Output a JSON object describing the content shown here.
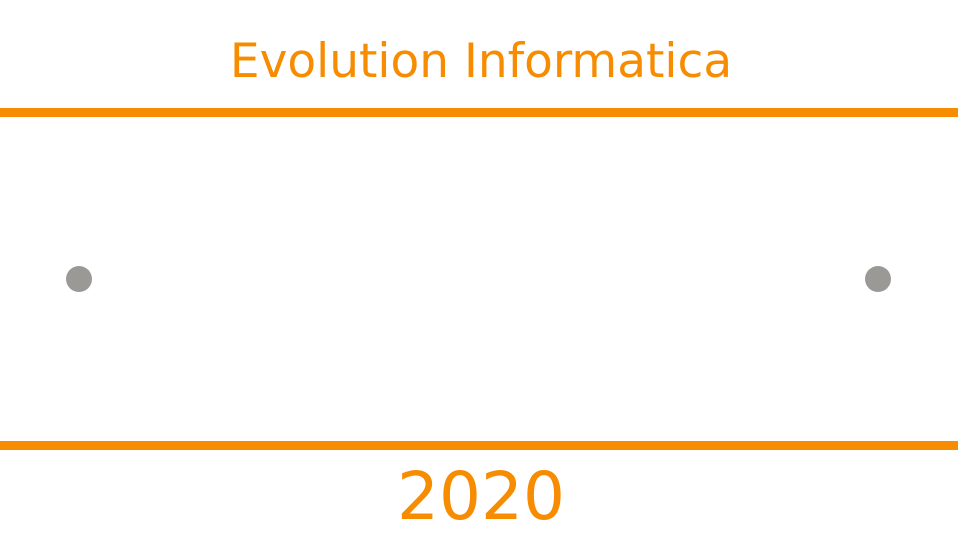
{
  "header": {
    "title": "Evolution Informatica"
  },
  "footer": {
    "year": "2020"
  },
  "colors": {
    "accent": "#f78c00",
    "dot": "#9b9996",
    "background": "#ffffff"
  }
}
